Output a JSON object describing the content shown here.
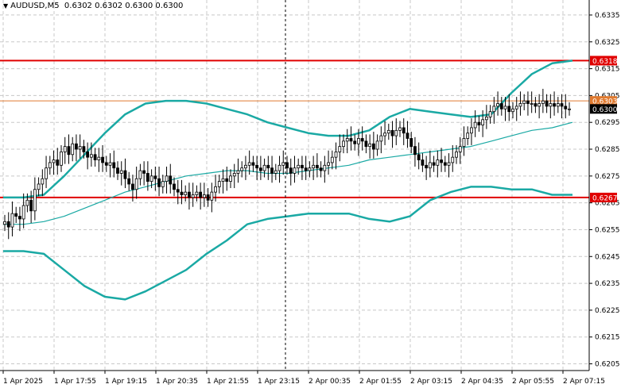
{
  "header": {
    "symbol": "AUDUSD,M5",
    "ohlc": "0.6302 0.6302 0.6300 0.6300"
  },
  "colors": {
    "background": "#ffffff",
    "grid": "#c8c8c8",
    "band": "#1aa9a4",
    "resistance": "#e00000",
    "bid_line": "#e07a30",
    "price_tag": "#000000",
    "candle": "#000000"
  },
  "chart_data": {
    "type": "candlestick",
    "symbol": "AUDUSD",
    "timeframe": "M5",
    "ylim": [
      0.62025,
      0.63406
    ],
    "y_ticks": [
      "0.6335",
      "0.6325",
      "0.6315",
      "0.6305",
      "0.6295",
      "0.6285",
      "0.6275",
      "0.6265",
      "0.6255",
      "0.6245",
      "0.6235",
      "0.6225",
      "0.6215",
      "0.6205"
    ],
    "x_ticks": [
      "1 Apr 2025",
      "1 Apr 17:55",
      "1 Apr 19:15",
      "1 Apr 20:35",
      "1 Apr 21:55",
      "1 Apr 23:15",
      "2 Apr 00:35",
      "2 Apr 01:55",
      "2 Apr 03:15",
      "2 Apr 04:35",
      "2 Apr 05:55",
      "2 Apr 07:15"
    ],
    "levels": [
      {
        "label": "0.6318",
        "value": 0.6318,
        "color": "#e00000",
        "kind": "resistance"
      },
      {
        "label": "0.6267",
        "value": 0.6267,
        "color": "#e00000",
        "kind": "support"
      }
    ],
    "bid": {
      "label": "0.6300",
      "value": 0.63
    },
    "ask": {
      "label": "0.6303",
      "value": 0.6303
    },
    "close_series": [
      0.6258,
      0.6256,
      0.6261,
      0.626,
      0.6259,
      0.6264,
      0.6266,
      0.6262,
      0.627,
      0.6272,
      0.6274,
      0.6278,
      0.628,
      0.6281,
      0.6279,
      0.6284,
      0.6286,
      0.6283,
      0.6287,
      0.6285,
      0.6286,
      0.6284,
      0.6282,
      0.6283,
      0.6281,
      0.6282,
      0.628,
      0.6279,
      0.628,
      0.6278,
      0.6276,
      0.6277,
      0.6274,
      0.6272,
      0.627,
      0.6274,
      0.6277,
      0.6276,
      0.6273,
      0.6275,
      0.6274,
      0.6271,
      0.6273,
      0.6275,
      0.6272,
      0.627,
      0.6269,
      0.6268,
      0.6269,
      0.6267,
      0.6268,
      0.6269,
      0.6267,
      0.6268,
      0.6266,
      0.6269,
      0.6271,
      0.6273,
      0.6274,
      0.6273,
      0.6275,
      0.6276,
      0.6277,
      0.6278,
      0.6279,
      0.628,
      0.6279,
      0.6278,
      0.6277,
      0.6279,
      0.6278,
      0.6276,
      0.6277,
      0.6279,
      0.628,
      0.6278,
      0.6276,
      0.6278,
      0.6279,
      0.6278,
      0.6277,
      0.6278,
      0.6279,
      0.6278,
      0.6277,
      0.6279,
      0.628,
      0.6282,
      0.6284,
      0.6286,
      0.6288,
      0.6289,
      0.6288,
      0.6287,
      0.6289,
      0.6288,
      0.6286,
      0.6287,
      0.6285,
      0.6288,
      0.629,
      0.6291,
      0.6292,
      0.629,
      0.6292,
      0.6293,
      0.6291,
      0.6289,
      0.6286,
      0.6283,
      0.6281,
      0.6279,
      0.6278,
      0.628,
      0.6279,
      0.6281,
      0.628,
      0.6279,
      0.628,
      0.6282,
      0.6284,
      0.6286,
      0.6289,
      0.6291,
      0.6293,
      0.6295,
      0.6294,
      0.6296,
      0.6297,
      0.6299,
      0.6301,
      0.6302,
      0.63,
      0.6301,
      0.6299,
      0.63,
      0.6301,
      0.6302,
      0.6303,
      0.6302,
      0.6302,
      0.6301,
      0.6302,
      0.6303,
      0.6301,
      0.6302,
      0.6301,
      0.6302,
      0.6301,
      0.63,
      0.63
    ],
    "bollinger": {
      "upper": [
        0.6267,
        0.6267,
        0.6268,
        0.6275,
        0.6283,
        0.6291,
        0.6298,
        0.6302,
        0.6303,
        0.6303,
        0.6302,
        0.63,
        0.6298,
        0.6295,
        0.6293,
        0.6291,
        0.629,
        0.629,
        0.6292,
        0.6297,
        0.63,
        0.6299,
        0.6298,
        0.6297,
        0.6298,
        0.6306,
        0.6313,
        0.6317,
        0.6318
      ],
      "middle": [
        0.6257,
        0.6257,
        0.6258,
        0.626,
        0.6263,
        0.6266,
        0.6269,
        0.6271,
        0.6273,
        0.6275,
        0.6276,
        0.6277,
        0.6277,
        0.6276,
        0.6276,
        0.6277,
        0.6278,
        0.6279,
        0.6281,
        0.6282,
        0.6283,
        0.6284,
        0.6285,
        0.6286,
        0.6288,
        0.629,
        0.6292,
        0.6293,
        0.6295
      ],
      "lower": [
        0.6247,
        0.6247,
        0.6246,
        0.624,
        0.6234,
        0.623,
        0.6229,
        0.6232,
        0.6236,
        0.624,
        0.6246,
        0.6251,
        0.6257,
        0.6259,
        0.626,
        0.6261,
        0.6261,
        0.6261,
        0.6259,
        0.6258,
        0.626,
        0.6266,
        0.6269,
        0.6271,
        0.6271,
        0.627,
        0.627,
        0.6268,
        0.6268
      ]
    }
  }
}
